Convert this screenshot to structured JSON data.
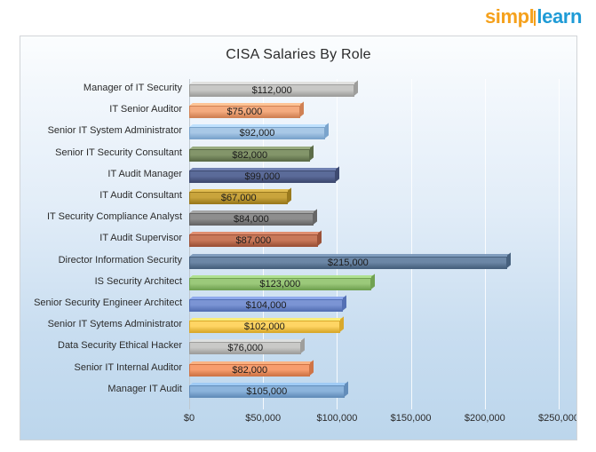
{
  "brand": {
    "part1": "simpl",
    "part2": "learn",
    "color1": "#f5a11c",
    "color2": "#1f9bd6"
  },
  "chart_data": {
    "type": "bar",
    "orientation": "horizontal",
    "title": "CISA Salaries By Role",
    "xlabel": "",
    "ylabel": "",
    "xlim": [
      0,
      250000
    ],
    "xticks": [
      0,
      50000,
      100000,
      150000,
      200000,
      250000
    ],
    "xtick_labels": [
      "$0",
      "$50,000",
      "$100,000",
      "$150,000",
      "$200,000",
      "$250,000"
    ],
    "grid": true,
    "legend": false,
    "categories": [
      "Manager of IT Security",
      "IT Senior Auditor",
      "Senior IT System Administrator",
      "Senior IT Security Consultant",
      "IT Audit Manager",
      "IT Audit Consultant",
      "IT Security Compliance Analyst",
      "IT Audit Supervisor",
      "Director Information Security",
      "IS Security Architect",
      "Senior Security Engineer Architect",
      "Senior IT Sytems Administrator",
      "Data Security Ethical Hacker",
      "Senior IT Internal Auditor",
      "Manager IT Audit"
    ],
    "values": [
      112000,
      75000,
      92000,
      82000,
      99000,
      67000,
      84000,
      87000,
      215000,
      123000,
      104000,
      102000,
      76000,
      82000,
      105000
    ],
    "value_labels": [
      "$112,000",
      "$75,000",
      "$92,000",
      "$82,000",
      "$99,000",
      "$67,000",
      "$84,000",
      "$87,000",
      "$215,000",
      "$123,000",
      "$104,000",
      "$102,000",
      "$76,000",
      "$82,000",
      "$105,000"
    ],
    "bar_colors": [
      "#c8c8c6",
      "#f4ab7f",
      "#a8c8e6",
      "#83956a",
      "#5b6b99",
      "#c9a43c",
      "#8e8e8e",
      "#c9795a",
      "#6c87a6",
      "#9bc97a",
      "#7b94d4",
      "#ffd564",
      "#c9c9c7",
      "#f79d6e",
      "#8cb4dc"
    ],
    "bar_colors_dark": [
      "#9e9e9c",
      "#d08154",
      "#7ba4cc",
      "#5c6c48",
      "#3e4a70",
      "#9a7a1e",
      "#666666",
      "#9c5238",
      "#47617e",
      "#71a252",
      "#5470b4",
      "#d9a92c",
      "#9e9e9c",
      "#cf7446",
      "#638dba"
    ]
  }
}
